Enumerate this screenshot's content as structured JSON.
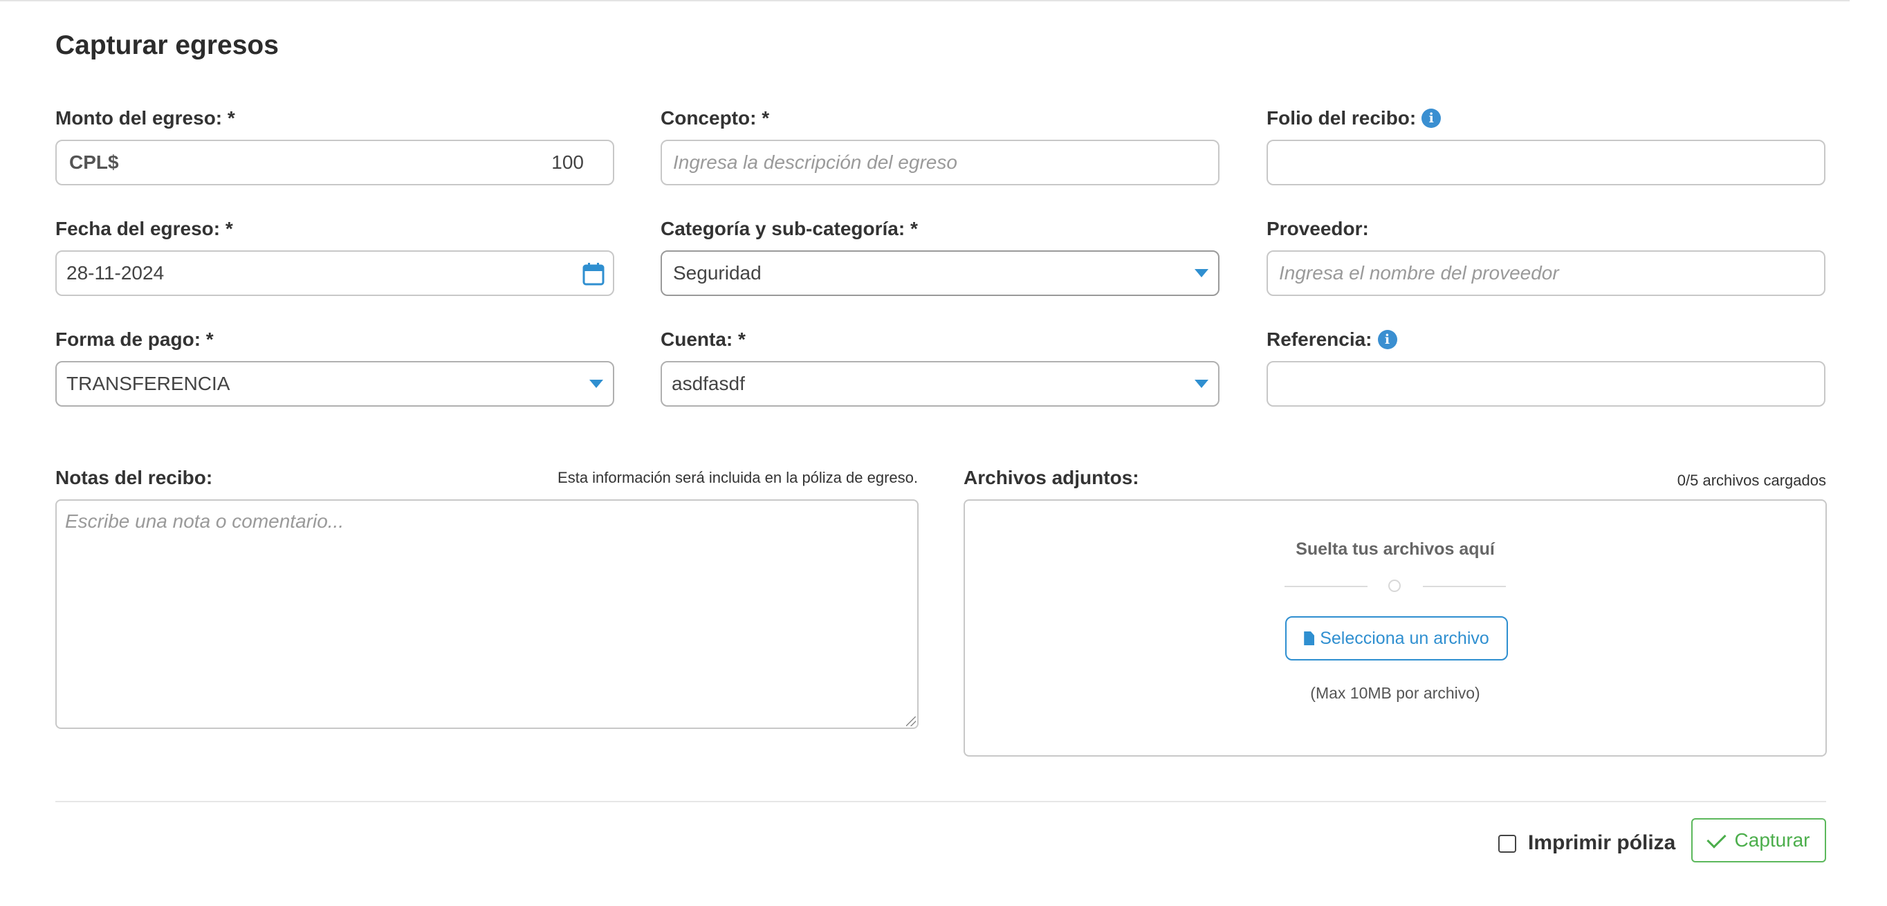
{
  "title": "Capturar egresos",
  "fields": {
    "monto": {
      "label": "Monto del egreso: *",
      "currency": "CPL$",
      "value": "100"
    },
    "concepto": {
      "label": "Concepto: *",
      "placeholder": "Ingresa la descripción del egreso"
    },
    "folio": {
      "label": "Folio del recibo:",
      "value": ""
    },
    "fecha": {
      "label": "Fecha del egreso: *",
      "value": "28-11-2024"
    },
    "categoria": {
      "label": "Categoría y sub-categoría: *",
      "value": "Seguridad"
    },
    "proveedor": {
      "label": "Proveedor:",
      "placeholder": "Ingresa el nombre del proveedor"
    },
    "forma_pago": {
      "label": "Forma de pago: *",
      "value": "TRANSFERENCIA"
    },
    "cuenta": {
      "label": "Cuenta: *",
      "value": "asdfasdf"
    },
    "referencia": {
      "label": "Referencia:",
      "value": ""
    }
  },
  "notes": {
    "label": "Notas del recibo:",
    "hint": "Esta información será incluida en la póliza de egreso.",
    "placeholder": "Escribe una nota o comentario..."
  },
  "attachments": {
    "label": "Archivos adjuntos:",
    "count": "0/5 archivos cargados",
    "drop_text": "Suelta tus archivos aquí",
    "select_label": "Selecciona un archivo",
    "max_text": "(Max 10MB por archivo)"
  },
  "footer": {
    "print_label": "Imprimir póliza",
    "submit_label": "Capturar"
  },
  "colors": {
    "accent": "#2f8fd0",
    "success": "#5cb85c"
  },
  "icons": {
    "info": "info-icon",
    "calendar": "calendar-icon",
    "file": "file-icon",
    "check": "check-icon"
  }
}
